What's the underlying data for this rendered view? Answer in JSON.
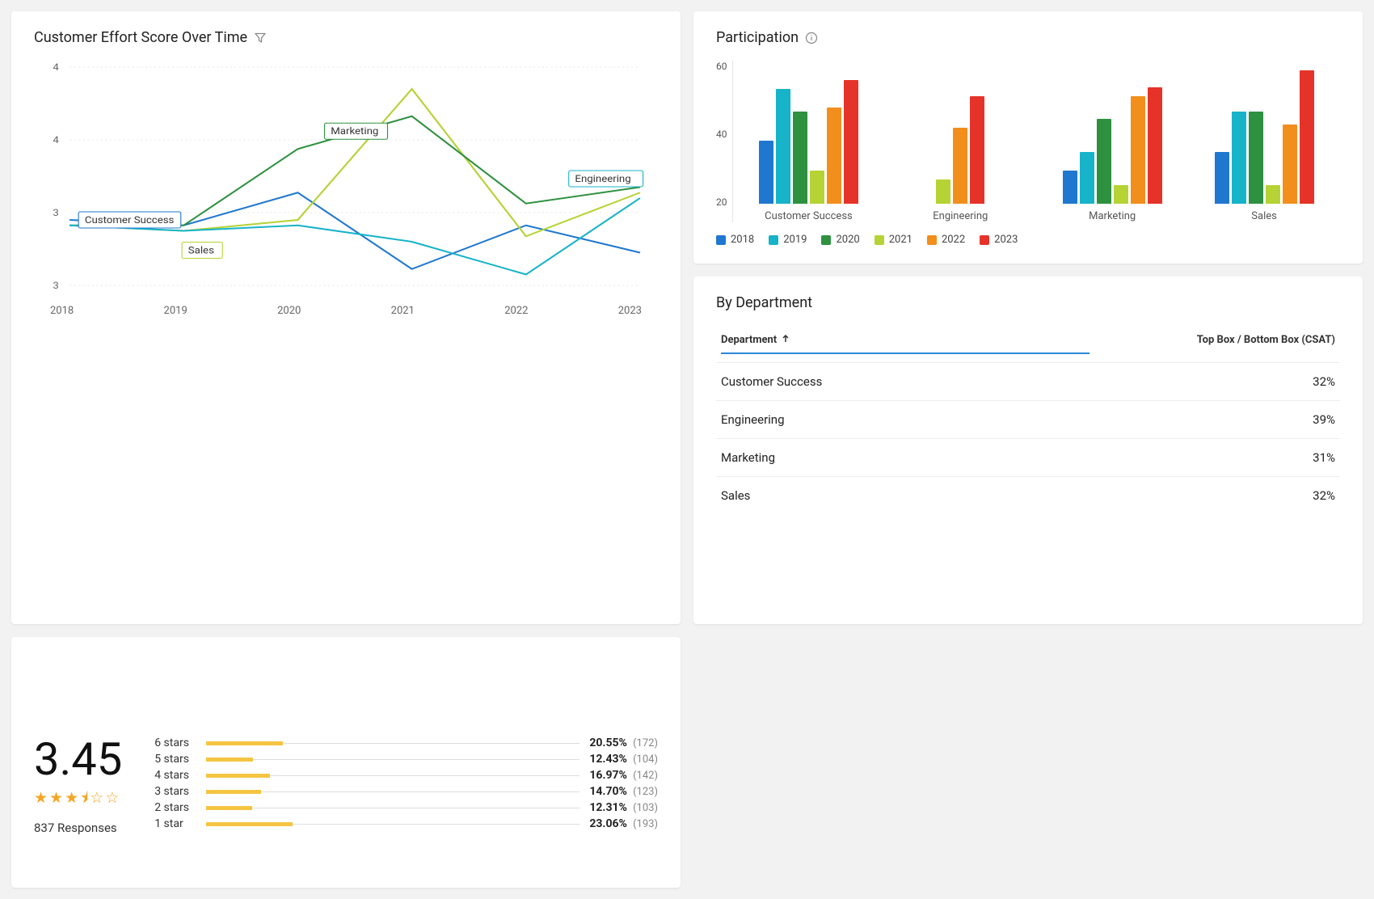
{
  "colors": {
    "2018": "#1f77d0",
    "2019": "#17b3c9",
    "2020": "#2e9140",
    "2021": "#b5d334",
    "2022": "#f28e1c",
    "2023": "#e6332a"
  },
  "participation": {
    "title": "Participation",
    "ylim_max": 70,
    "yticks": [
      "60",
      "40",
      "20"
    ]
  },
  "by_department": {
    "title": "By Department",
    "col_dept": "Department",
    "col_metric": "Top Box / Bottom Box (CSAT)",
    "rows": [
      {
        "dept": "Customer Success",
        "val": "32%"
      },
      {
        "dept": "Engineering",
        "val": "39%"
      },
      {
        "dept": "Marketing",
        "val": "31%"
      },
      {
        "dept": "Sales",
        "val": "32%"
      }
    ]
  },
  "ces_chart": {
    "title": "Customer Effort Score Over Time",
    "yticks": [
      "4",
      "4",
      "3",
      "3"
    ],
    "labels": {
      "cs": "Customer Success",
      "sales": "Sales",
      "mkt": "Marketing",
      "eng": "Engineering"
    }
  },
  "rating": {
    "value": "3.45",
    "responses": "837 Responses",
    "rows": [
      {
        "label": "6 stars",
        "pct": "20.55%",
        "count": "(172)",
        "w": 20.55
      },
      {
        "label": "5 stars",
        "pct": "12.43%",
        "count": "(104)",
        "w": 12.43
      },
      {
        "label": "4 stars",
        "pct": "16.97%",
        "count": "(142)",
        "w": 16.97
      },
      {
        "label": "3 stars",
        "pct": "14.70%",
        "count": "(123)",
        "w": 14.7
      },
      {
        "label": "2 stars",
        "pct": "12.31%",
        "count": "(103)",
        "w": 12.31
      },
      {
        "label": "1 star",
        "pct": "23.06%",
        "count": "(193)",
        "w": 23.06
      }
    ]
  },
  "chart_data": [
    {
      "type": "bar",
      "title": "Participation",
      "xlabel": "",
      "ylabel": "",
      "ylim": [
        0,
        70
      ],
      "categories": [
        "Customer Success",
        "Engineering",
        "Marketing",
        "Sales"
      ],
      "series": [
        {
          "name": "2018",
          "values": [
            34,
            0,
            18,
            28
          ]
        },
        {
          "name": "2019",
          "values": [
            62,
            0,
            28,
            50
          ]
        },
        {
          "name": "2020",
          "values": [
            50,
            0,
            46,
            50
          ]
        },
        {
          "name": "2021",
          "values": [
            18,
            13,
            10,
            10
          ]
        },
        {
          "name": "2022",
          "values": [
            52,
            41,
            58,
            43
          ]
        },
        {
          "name": "2023",
          "values": [
            67,
            58,
            63,
            72
          ]
        }
      ]
    },
    {
      "type": "line",
      "title": "Customer Effort Score Over Time",
      "xlabel": "",
      "ylabel": "",
      "ylim": [
        2.5,
        4.5
      ],
      "x": [
        "2018",
        "2019",
        "2020",
        "2021",
        "2022",
        "2023"
      ],
      "series": [
        {
          "name": "Customer Success",
          "values": [
            3.1,
            3.05,
            3.35,
            2.65,
            3.05,
            2.8
          ]
        },
        {
          "name": "Sales",
          "values": [
            3.05,
            3.0,
            3.1,
            4.3,
            2.95,
            3.35
          ]
        },
        {
          "name": "Marketing",
          "values": [
            3.05,
            3.05,
            3.75,
            4.05,
            3.25,
            3.4
          ]
        },
        {
          "name": "Engineering",
          "values": [
            3.05,
            3.0,
            3.05,
            2.9,
            2.6,
            3.3
          ]
        }
      ]
    },
    {
      "type": "table",
      "title": "By Department",
      "columns": [
        "Department",
        "Top Box / Bottom Box (CSAT)"
      ],
      "rows": [
        [
          "Customer Success",
          "32%"
        ],
        [
          "Engineering",
          "39%"
        ],
        [
          "Marketing",
          "31%"
        ],
        [
          "Sales",
          "32%"
        ]
      ]
    },
    {
      "type": "bar",
      "title": "Star Rating Distribution",
      "overall": 3.45,
      "responses": 837,
      "categories": [
        "6 stars",
        "5 stars",
        "4 stars",
        "3 stars",
        "2 stars",
        "1 star"
      ],
      "values_pct": [
        20.55,
        12.43,
        16.97,
        14.7,
        12.31,
        23.06
      ],
      "counts": [
        172,
        104,
        142,
        123,
        103,
        193
      ]
    }
  ]
}
